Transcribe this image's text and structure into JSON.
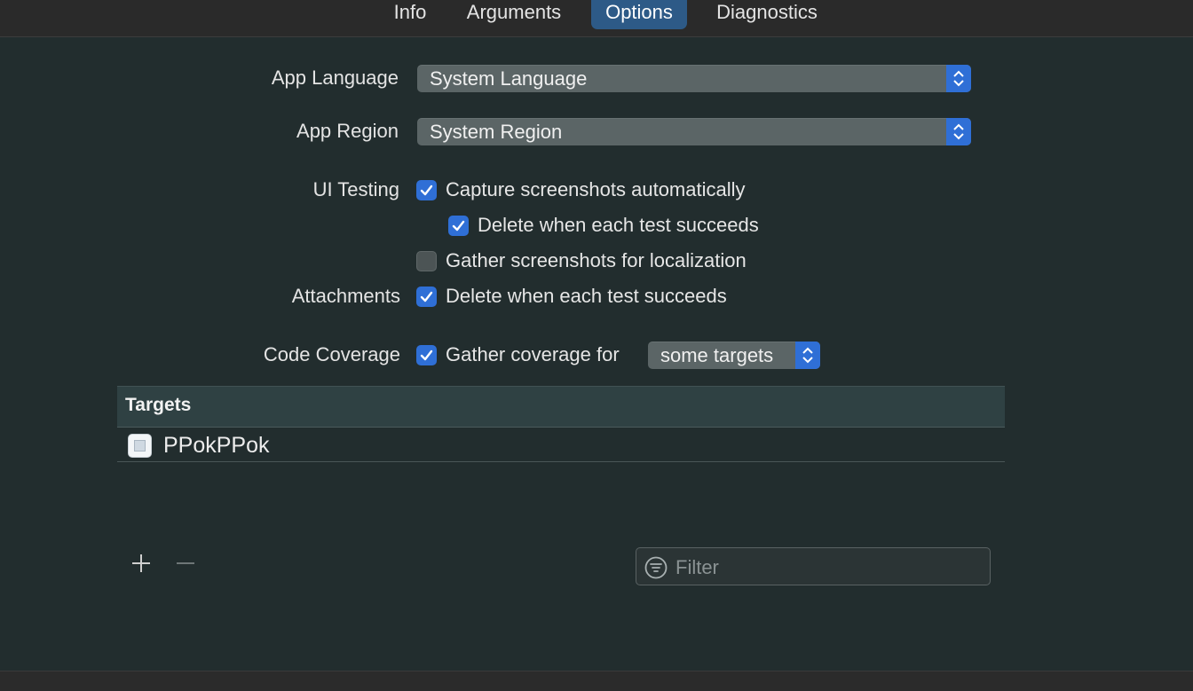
{
  "tabs": [
    {
      "label": "Info"
    },
    {
      "label": "Arguments"
    },
    {
      "label": "Options",
      "active": true
    },
    {
      "label": "Diagnostics"
    }
  ],
  "app_language": {
    "label": "App Language",
    "value": "System Language"
  },
  "app_region": {
    "label": "App Region",
    "value": "System Region"
  },
  "ui_testing": {
    "label": "UI Testing",
    "capture": {
      "label": "Capture screenshots automatically",
      "checked": true
    },
    "delete_success": {
      "label": "Delete when each test succeeds",
      "checked": true
    },
    "gather_localization": {
      "label": "Gather screenshots for localization",
      "checked": false
    }
  },
  "attachments": {
    "label": "Attachments",
    "delete_success": {
      "label": "Delete when each test succeeds",
      "checked": true
    }
  },
  "code_coverage": {
    "label": "Code Coverage",
    "gather": {
      "label": "Gather coverage for",
      "checked": true
    },
    "scope_value": "some targets"
  },
  "targets_table": {
    "header": "Targets",
    "rows": [
      {
        "name": "PPokPPok",
        "icon": "app-icon"
      }
    ]
  },
  "filter": {
    "placeholder": "Filter",
    "value": ""
  },
  "colors": {
    "accent": "#2f6fd6",
    "background": "#222d2e",
    "active_tab": "#2d5a87"
  }
}
